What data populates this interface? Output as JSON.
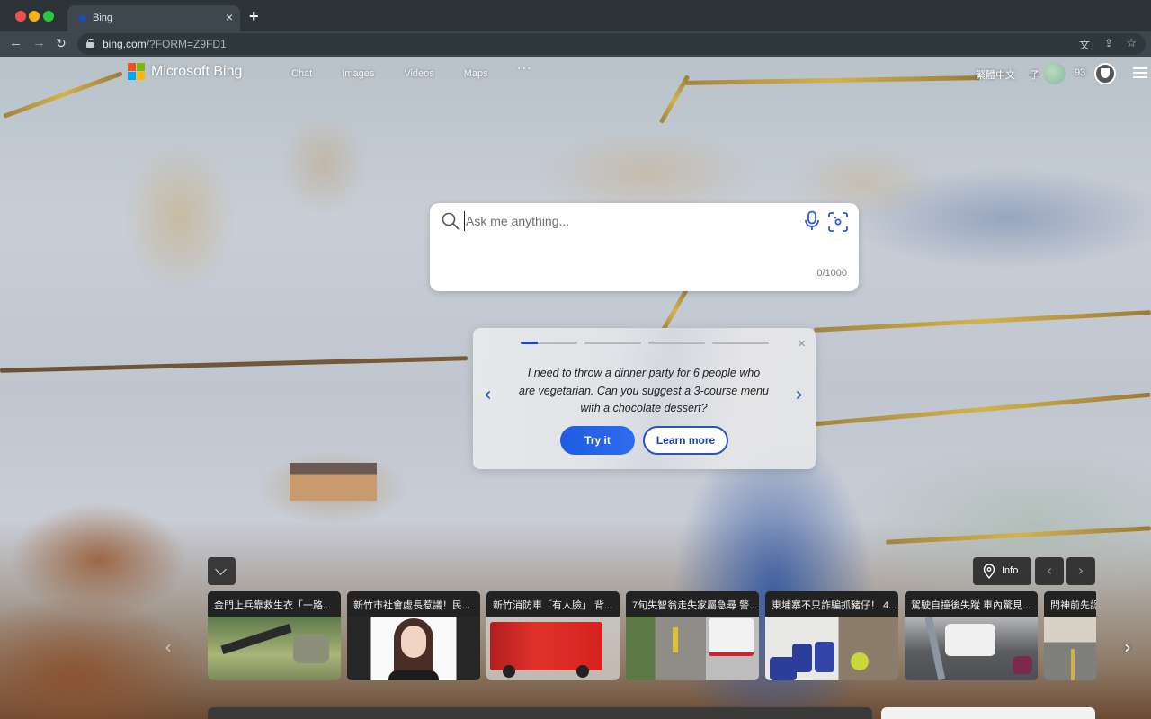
{
  "browser": {
    "tab_title": "Bing",
    "tab_close": "×",
    "new_tab": "+",
    "url_host": "bing.com",
    "url_rest": "/?FORM=Z9FD1",
    "back": "←",
    "forward": "→",
    "reload": "↻",
    "translate_icon": "文",
    "share_icon": "⇪",
    "bookmark_icon": "☆"
  },
  "header": {
    "brand": "Microsoft Bing",
    "nav": [
      "Chat",
      "Images",
      "Videos",
      "Maps"
    ],
    "more": "···",
    "language": "繁體中文",
    "user_name": "子",
    "points": "93",
    "logo_colors": [
      "#f25022",
      "#7fba00",
      "#00a4ef",
      "#ffb900"
    ]
  },
  "search": {
    "placeholder": "Ask me anything...",
    "value": "",
    "char_count": "0/1000",
    "accent_color": "#2a5bd7"
  },
  "suggestion": {
    "text": "I need to throw a dinner party for 6 people who are vegetarian. Can you suggest a 3-course menu with a chocolate dessert?",
    "try_label": "Try it",
    "learn_label": "Learn more",
    "close": "×",
    "prev": "‹",
    "next": "›",
    "steps": [
      {
        "progress": 0.3
      },
      {
        "progress": 0
      },
      {
        "progress": 0
      },
      {
        "progress": 0
      }
    ]
  },
  "image_controls": {
    "info_label": "Info",
    "prev": "‹",
    "next": "›"
  },
  "news": {
    "items": [
      {
        "title": "金門上兵靠救生衣「一路...",
        "thumb": "soldier-gear"
      },
      {
        "title": "新竹市社會處長惹議！民...",
        "thumb": "portrait"
      },
      {
        "title": "新竹消防車「有人臉」 背...",
        "thumb": "fire-truck"
      },
      {
        "title": "7旬失智翁走失家屬急尋 警...",
        "thumb": "ambulance-street"
      },
      {
        "title": "東埔寨不只詐騙抓豬仔！ 4...",
        "thumb": "blue-barrels"
      },
      {
        "title": "駕駛自撞後失蹤 車內驚見...",
        "thumb": "car-crash"
      },
      {
        "title": "問神前先認",
        "thumb": "street-building"
      }
    ],
    "prev": "‹",
    "next": "›"
  }
}
